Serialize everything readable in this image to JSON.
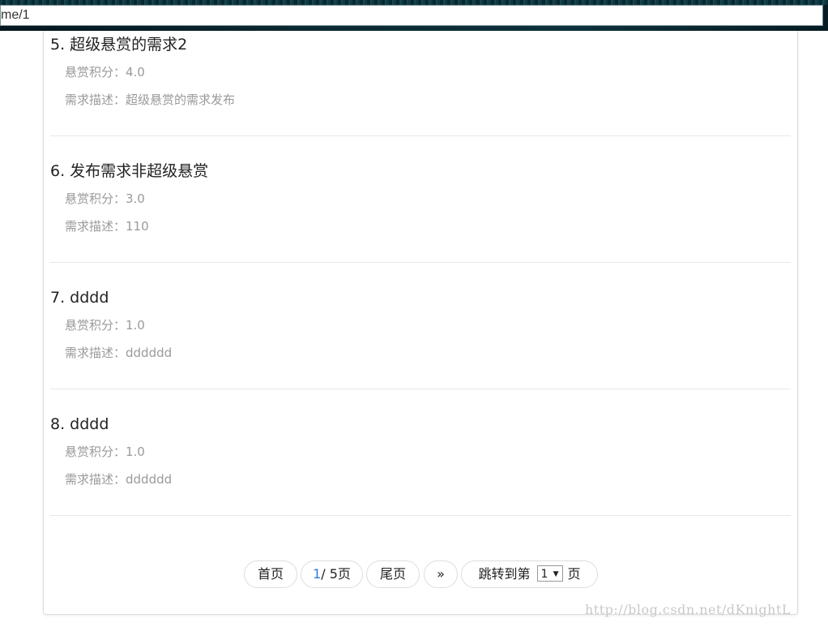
{
  "browser": {
    "url": "me/1"
  },
  "items": [
    {
      "title": "5. 超级悬赏的需求2",
      "reward": "悬赏积分：4.0",
      "desc": "需求描述：超级悬赏的需求发布"
    },
    {
      "title": "6. 发布需求非超级悬赏",
      "reward": "悬赏积分：3.0",
      "desc": "需求描述：110"
    },
    {
      "title": "7. dddd",
      "reward": "悬赏积分：1.0",
      "desc": "需求描述：dddddd"
    },
    {
      "title": "8. dddd",
      "reward": "悬赏积分：1.0",
      "desc": "需求描述：dddddd"
    }
  ],
  "pagination": {
    "first": "首页",
    "current_page": "1",
    "total_pages": "/ 5页",
    "last": "尾页",
    "next": "»",
    "jump_prefix": "跳转到第",
    "jump_value": "1",
    "jump_suffix": "页"
  },
  "watermark": "http://blog.csdn.net/dKnightL",
  "colors": {
    "accent": "#2a7ae2",
    "muted_text": "#9a9a9a",
    "title_text": "#222222"
  }
}
